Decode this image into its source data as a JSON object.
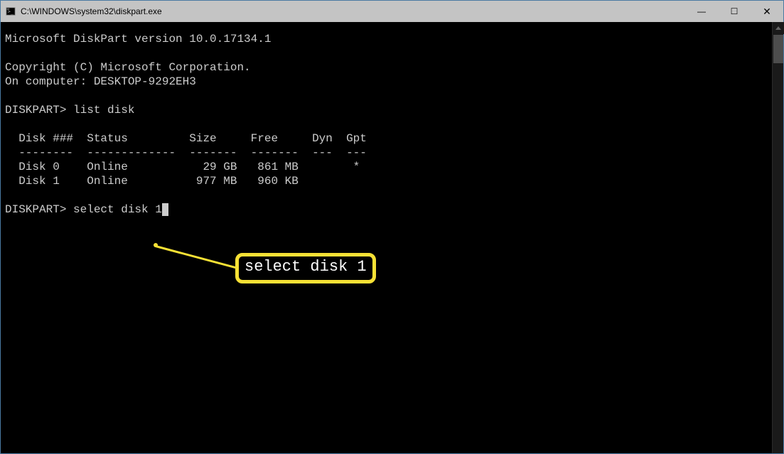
{
  "window": {
    "title": "C:\\WINDOWS\\system32\\diskpart.exe",
    "controls": {
      "minimize": "—",
      "maximize": "☐",
      "close": "✕"
    }
  },
  "terminal": {
    "line1_version": "Microsoft DiskPart version 10.0.17134.1",
    "line2_blank": "",
    "line3_copyright": "Copyright (C) Microsoft Corporation.",
    "line4_computer": "On computer: DESKTOP-9292EH3",
    "line5_blank": "",
    "prompt1_prefix": "DISKPART> ",
    "prompt1_cmd": "list disk",
    "table_blank_before": "",
    "table_header": "  Disk ###  Status         Size     Free     Dyn  Gpt",
    "table_rule": "  --------  -------------  -------  -------  ---  ---",
    "table_row0": "  Disk 0    Online           29 GB   861 MB        *",
    "table_row1": "  Disk 1    Online          977 MB   960 KB",
    "table_blank_after": "",
    "prompt2_prefix": "DISKPART> ",
    "prompt2_cmd": "select disk 1"
  },
  "callout": {
    "text": "select disk 1"
  }
}
